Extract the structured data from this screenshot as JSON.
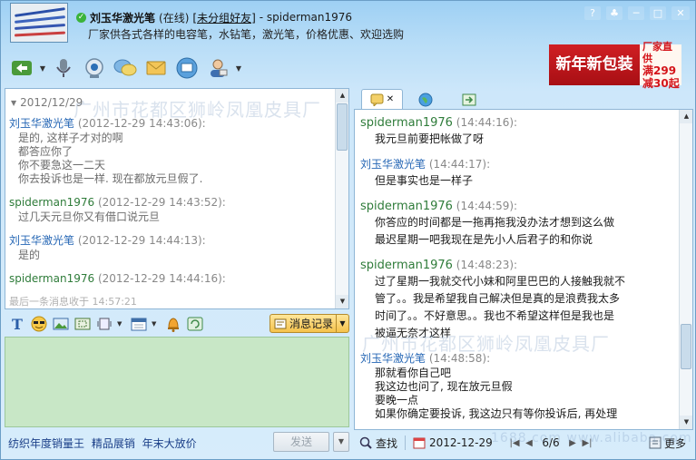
{
  "header": {
    "contact_name": "刘玉华激光笔",
    "status": "(在线)",
    "group": "[未分组好友]",
    "self_label": "- spiderman1976",
    "signature": "厂家供各式各样的电容笔，水钻笔，激光笔，价格优惠、欢迎选购"
  },
  "window_controls": [
    "?",
    "♣",
    "─",
    "□",
    "✕"
  ],
  "ad": {
    "main": "新年新包装",
    "line1": "厂家直供",
    "line2": "满299",
    "line3": "减30起"
  },
  "left_history": {
    "date_separator": "2012/12/29",
    "messages": [
      {
        "sender": "刘玉华激光笔",
        "time": "(2012-12-29 14:43:06):",
        "lines": [
          "是的, 这样子才对的啊",
          "都答应你了",
          "你不要急这一二天",
          "你去投诉也是一样. 现在都放元旦假了."
        ],
        "self": false
      },
      {
        "sender": "spiderman1976",
        "time": "(2012-12-29 14:43:52):",
        "lines": [
          "过几天元旦你又有借口说元旦"
        ],
        "self": true
      },
      {
        "sender": "刘玉华激光笔",
        "time": "(2012-12-29 14:44:13):",
        "lines": [
          "是的"
        ],
        "self": false
      },
      {
        "sender": "spiderman1976",
        "time": "(2012-12-29 14:44:16):",
        "lines": [],
        "self": true
      }
    ],
    "footer": "最后一条消息收于 14:57:21"
  },
  "edit_toolbar": {
    "message_record_label": "消息记录"
  },
  "bottom": {
    "promo": "纺织年度销量王 精品展销 年末大放价",
    "send_label": "发送"
  },
  "right_history": {
    "messages": [
      {
        "sender": "spiderman1976",
        "time": "(14:44:16):",
        "lines": [
          "我元旦前要把帐做了呀"
        ],
        "self": true
      },
      {
        "sender": "刘玉华激光笔",
        "time": "(14:44:17):",
        "lines": [
          "但是事实也是一样子"
        ],
        "self": false
      },
      {
        "sender": "spiderman1976",
        "time": "(14:44:59):",
        "lines": [
          "你答应的时间都是一拖再拖我没办法才想到这么做",
          "最迟星期一吧我现在是先小人后君子的和你说"
        ],
        "self": true
      },
      {
        "sender": "spiderman1976",
        "time": "(14:48:23):",
        "lines": [
          "过了星期一我就交代小妹和阿里巴巴的人接触我就不",
          "管了。。我是希望我自己解决但是真的是浪费我太多",
          "时间了。。不好意思。。我也不希望这样但是我也是",
          "被逼无奈才这样"
        ],
        "self": true
      },
      {
        "sender": "刘玉华激光笔",
        "time": "(14:48:58):",
        "lines": [
          "那就看你自己吧",
          "我这边也问了, 现在放元旦假",
          "要晚一点",
          "如果你确定要投诉, 我这边只有等你投诉后, 再处理"
        ],
        "self": false
      }
    ]
  },
  "right_bottom": {
    "search_label": "查找",
    "date": "2012-12-29",
    "page": "6/6",
    "more_label": "更多"
  },
  "watermark": {
    "left": "广州市花都区狮岭凤凰皮具厂",
    "right": "广州市花都区狮岭凤凰皮具厂",
    "bottom": "1688.com www.alibaba.com"
  },
  "colors": {
    "accent_blue": "#2667b5",
    "self_green": "#2f7c3a",
    "input_bg": "#c8e7c6",
    "ad_red": "#c4161c"
  }
}
